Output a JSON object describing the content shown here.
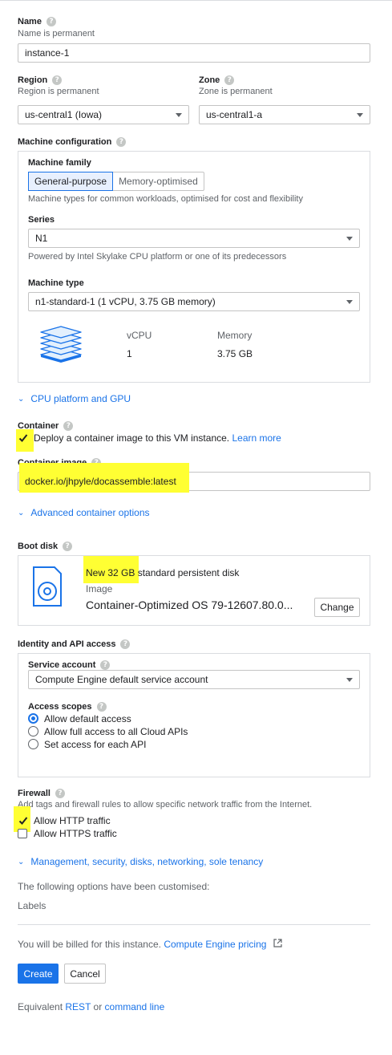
{
  "name": {
    "label": "Name",
    "hint": "Name is permanent",
    "value": "instance-1"
  },
  "region": {
    "label": "Region",
    "hint": "Region is permanent",
    "value": "us-central1 (Iowa)"
  },
  "zone": {
    "label": "Zone",
    "hint": "Zone is permanent",
    "value": "us-central1-a"
  },
  "machine_config": {
    "label": "Machine configuration",
    "family_label": "Machine family",
    "tabs": [
      "General-purpose",
      "Memory-optimised"
    ],
    "family_desc": "Machine types for common workloads, optimised for cost and flexibility",
    "series_label": "Series",
    "series_value": "N1",
    "series_desc": "Powered by Intel Skylake CPU platform or one of its predecessors",
    "type_label": "Machine type",
    "type_value": "n1-standard-1 (1 vCPU, 3.75 GB memory)",
    "vcpu_header": "vCPU",
    "vcpu_value": "1",
    "memory_header": "Memory",
    "memory_value": "3.75 GB"
  },
  "cpu_platform_link": "CPU platform and GPU",
  "container": {
    "label": "Container",
    "checkbox_label": "Deploy a container image to this VM instance.",
    "learn_more": "Learn more",
    "image_label": "Container image",
    "image_value": "docker.io/jhpyle/docassemble:latest",
    "advanced_link": "Advanced container options"
  },
  "boot_disk": {
    "label": "Boot disk",
    "size_text": "New 32 GB",
    "type_text": "standard persistent disk",
    "image_label": "Image",
    "image_value": "Container-Optimized OS 79-12607.80.0...",
    "change_button": "Change"
  },
  "identity": {
    "label": "Identity and API access",
    "service_label": "Service account",
    "service_value": "Compute Engine default service account",
    "scopes_label": "Access scopes",
    "scopes": [
      "Allow default access",
      "Allow full access to all Cloud APIs",
      "Set access for each API"
    ]
  },
  "firewall": {
    "label": "Firewall",
    "desc": "Add tags and firewall rules to allow specific network traffic from the Internet.",
    "http": "Allow HTTP traffic",
    "https": "Allow HTTPS traffic"
  },
  "management_link": "Management, security, disks, networking, sole tenancy",
  "customised_text": "The following options have been customised:",
  "customised_item": "Labels",
  "billing": {
    "text": "You will be billed for this instance.",
    "link": "Compute Engine pricing"
  },
  "buttons": {
    "create": "Create",
    "cancel": "Cancel"
  },
  "equivalent": {
    "prefix": "Equivalent",
    "rest": "REST",
    "or": "or",
    "command": "command line"
  },
  "colors": {
    "accent": "#1a73e8",
    "highlight": "#ffff33",
    "primary_button": "#1a73e8"
  }
}
